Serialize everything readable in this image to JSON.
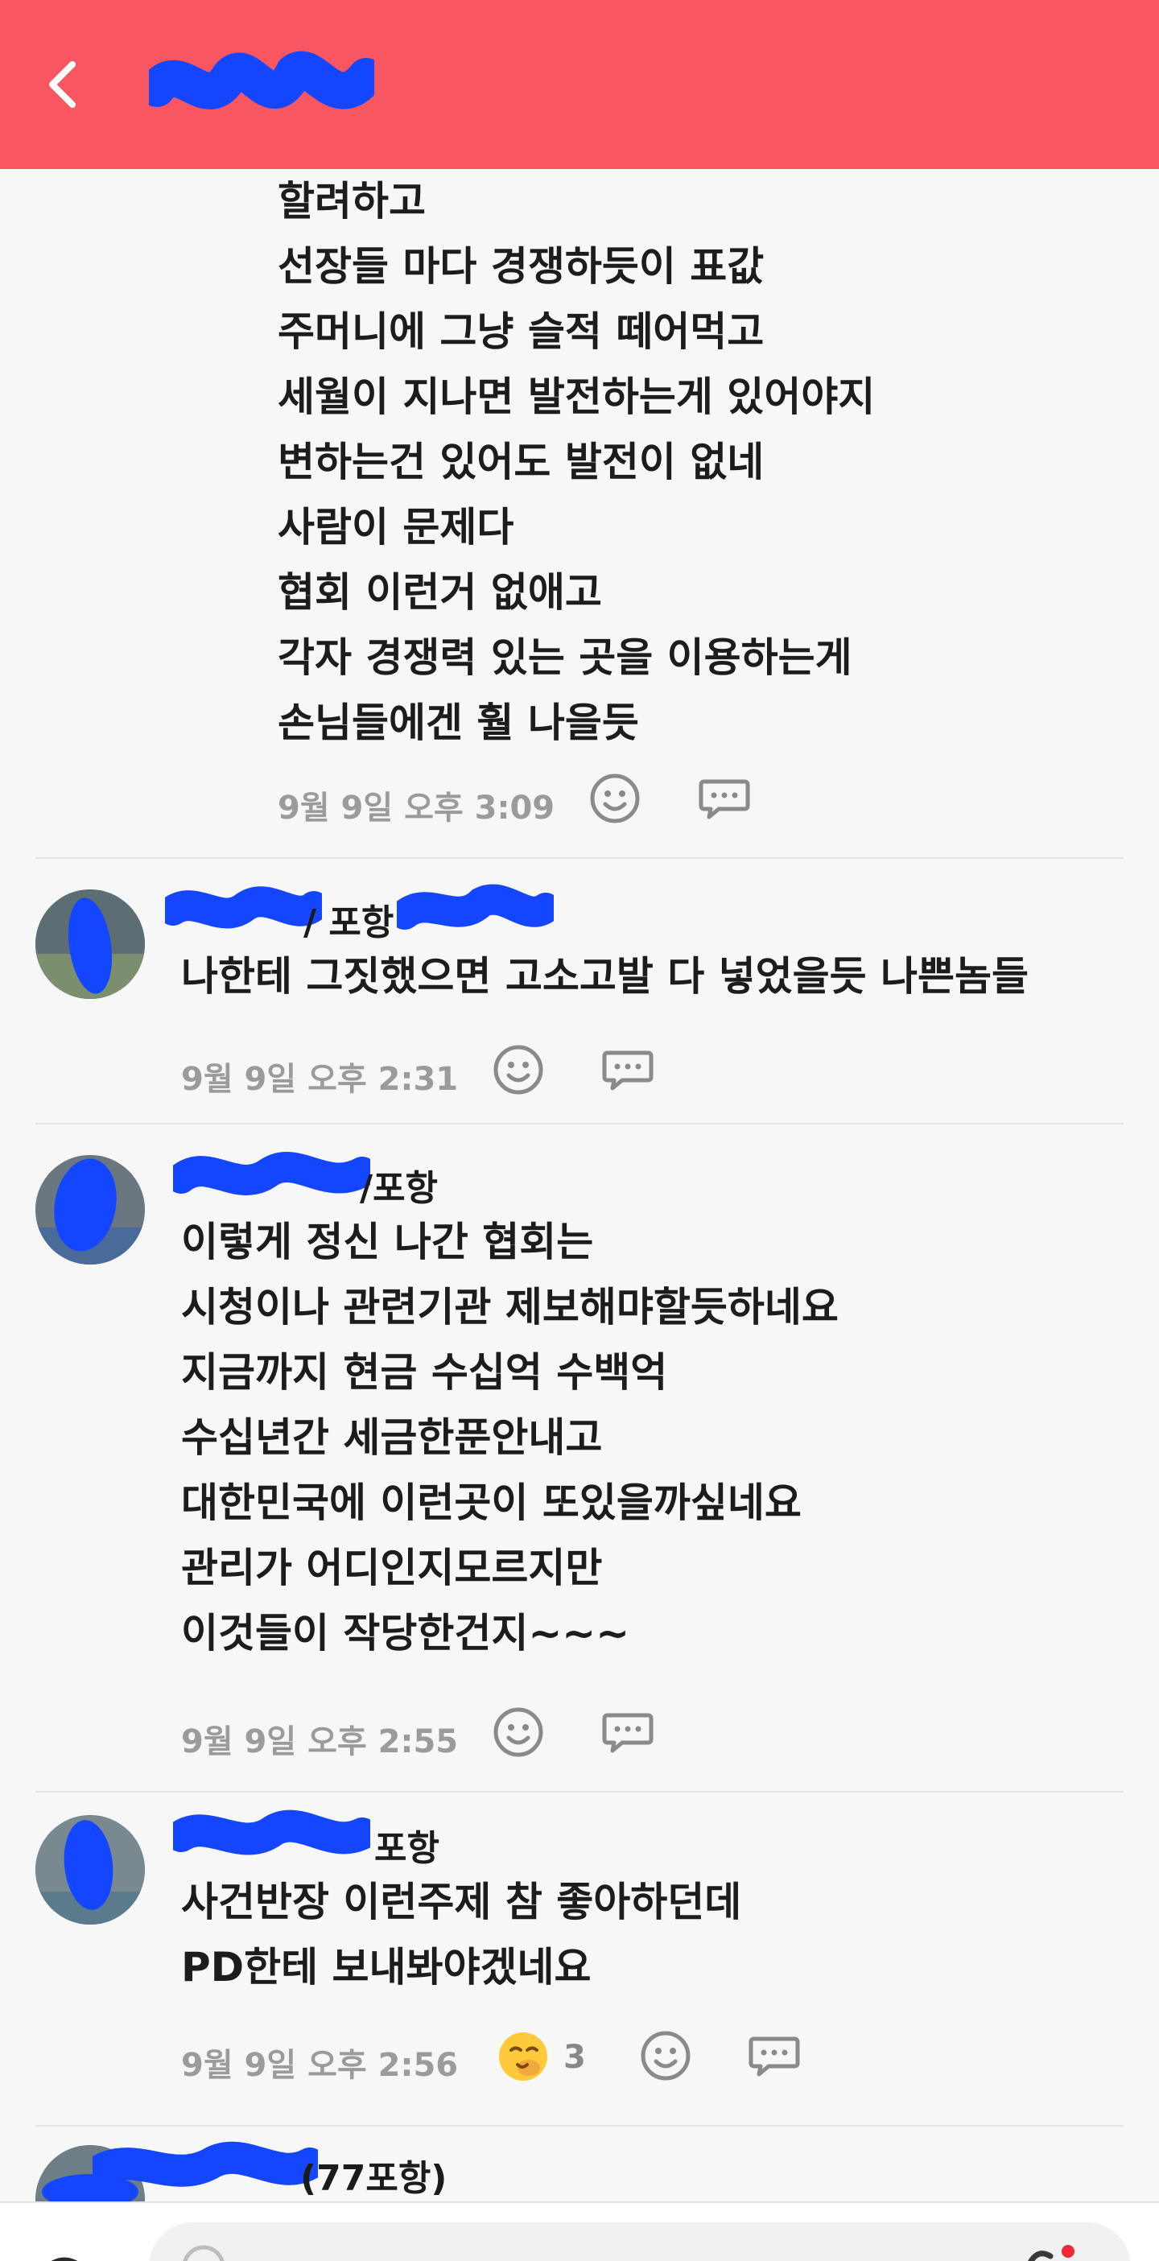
{
  "header": {
    "back_icon": "chevron-left-icon",
    "title_obscured": true,
    "background_color": "#f85762"
  },
  "comments": [
    {
      "body": [
        "할려하고",
        "선장들 마다 경쟁하듯이 표값",
        "주머니에 그냥 슬적 떼어먹고",
        "세월이 지나면 발전하는게 있어야지",
        "변하는건 있어도 발전이 없네",
        "사람이 문제다",
        "협회 이런거 없애고",
        "각자 경쟁력 있는 곳을 이용하는게",
        "손님들에겐 훨 나을듯"
      ],
      "time": "9월 9일 오후 3:09"
    },
    {
      "name_visible": "/ 포항",
      "body": [
        "나한테 그짓했으면 고소고발 다 넣었을듯 나쁜놈들"
      ],
      "time": "9월 9일 오후 2:31"
    },
    {
      "name_visible": "/포항",
      "body": [
        "이렇게 정신 나간 협회는",
        "시청이나 관련기관 제보해먀할듯하네요",
        "지금까지 현금 수십억 수백억",
        "수십년간 세금한푼안내고",
        "대한민국에 이런곳이 또있을까싶네요",
        "관리가 어디인지모르지만",
        "이것들이 작당한건지~~~"
      ],
      "time": "9월 9일 오후 2:55"
    },
    {
      "name_visible": "포항",
      "body": [
        "사건반장 이런주제 참 좋아하던데",
        "PD한테 보내봐야겠네요"
      ],
      "time": "9월 9일 오후 2:56",
      "reaction_icon": "salute-face-emoji",
      "reaction_count": "3"
    },
    {
      "name_visible": "(77포항)"
    }
  ],
  "icons": {
    "react": "smiley-icon",
    "reply": "speech-bubble-icon"
  },
  "colors": {
    "accent": "#f85762",
    "redaction": "#1546ff",
    "meta_text": "#9b9b9b"
  }
}
